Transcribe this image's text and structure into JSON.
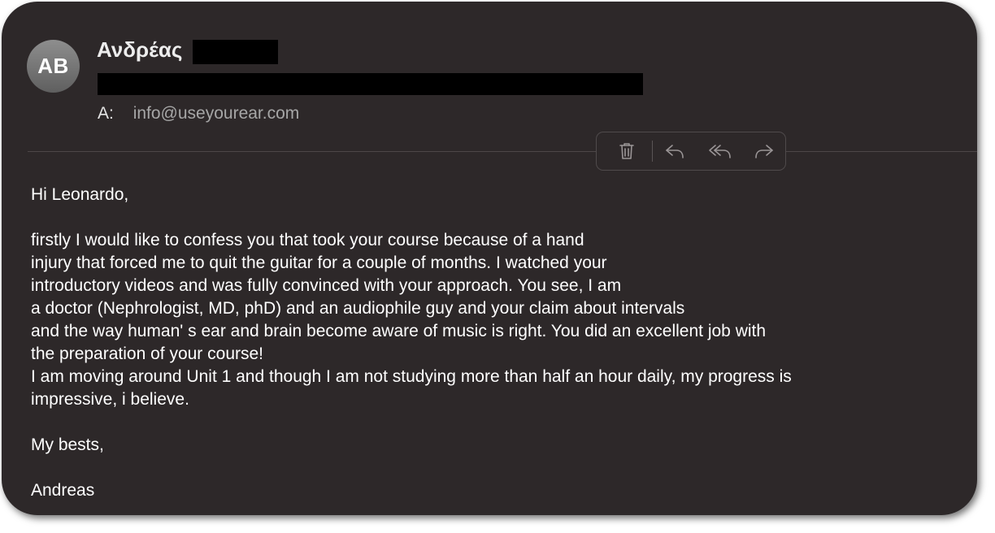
{
  "header": {
    "avatar_initials": "AB",
    "sender_name": "Ανδρέας",
    "to_label": "A:",
    "to_address": "info@useyourear.com"
  },
  "toolbar": {
    "icons": [
      "trash-icon",
      "reply-icon",
      "reply-all-icon",
      "forward-icon"
    ]
  },
  "message": {
    "greeting": "Hi Leonardo,",
    "lines": [
      "firstly I would like to confess you that took your course because of a hand",
      "injury that forced me to quit the guitar for a couple of months. I watched your",
      "introductory videos and was fully convinced with your approach. You see, I am",
      "a doctor (Nephrologist, MD, phD) and an audiophile guy and your claim about intervals",
      "and the way human' s ear and brain become aware of music is right. You did an excellent job with",
      "the preparation of your course!",
      "I am moving around Unit 1 and though I am not studying more than half an hour daily, my progress is",
      "impressive, i believe."
    ],
    "closing": "My bests,",
    "signature": "Andreas"
  },
  "colors": {
    "background": "#2d2829",
    "text": "#ffffff",
    "muted": "#a6a6a6",
    "icon": "#9a9596"
  }
}
